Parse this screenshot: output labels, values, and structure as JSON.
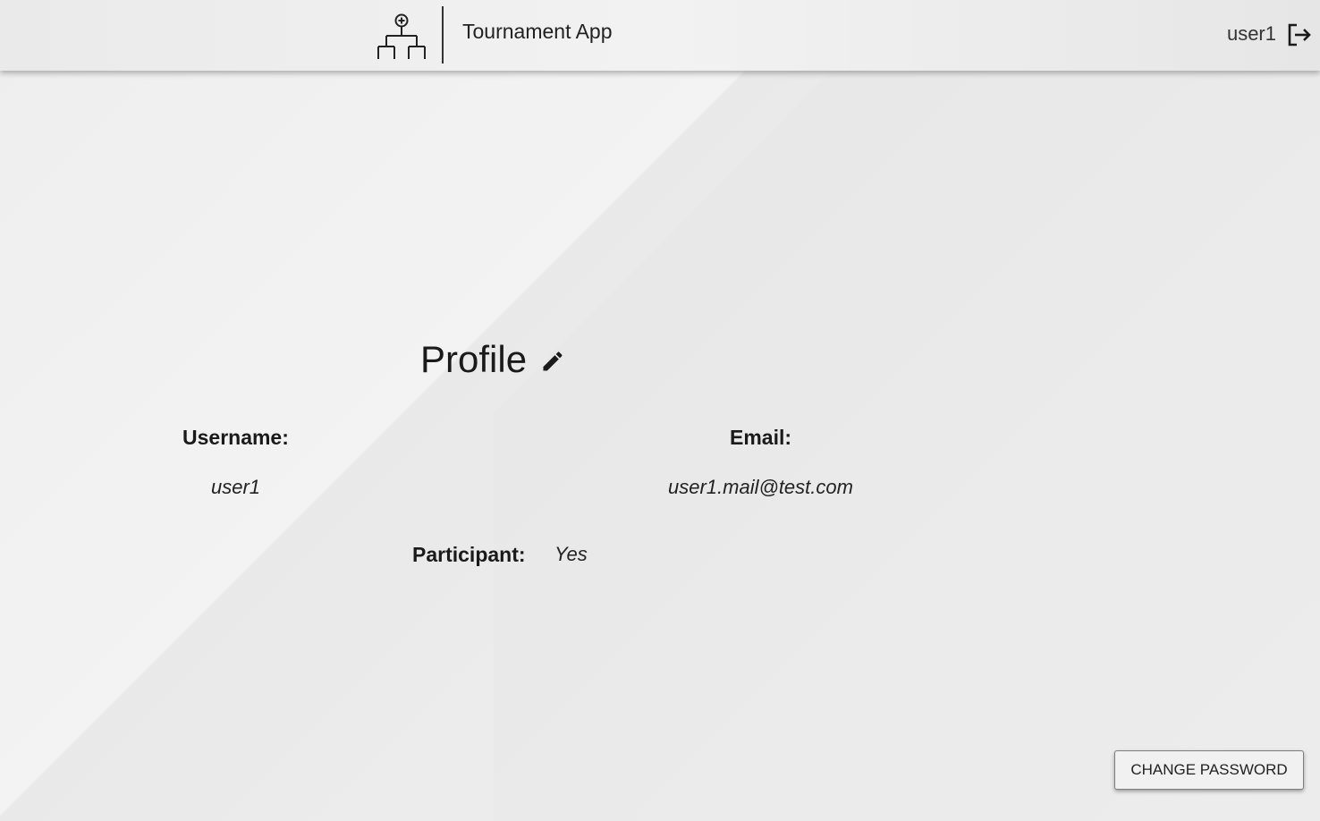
{
  "header": {
    "app_title": "Tournament App",
    "username": "user1",
    "logo_icon": "tournament-bracket-icon",
    "logout_icon": "logout-icon"
  },
  "profile": {
    "title": "Profile",
    "edit_icon": "pencil-icon",
    "username_label": "Username:",
    "username_value": "user1",
    "email_label": "Email:",
    "email_value": "user1.mail@test.com",
    "participant_label": "Participant:",
    "participant_value": "Yes"
  },
  "actions": {
    "change_password_label": "CHANGE PASSWORD"
  }
}
